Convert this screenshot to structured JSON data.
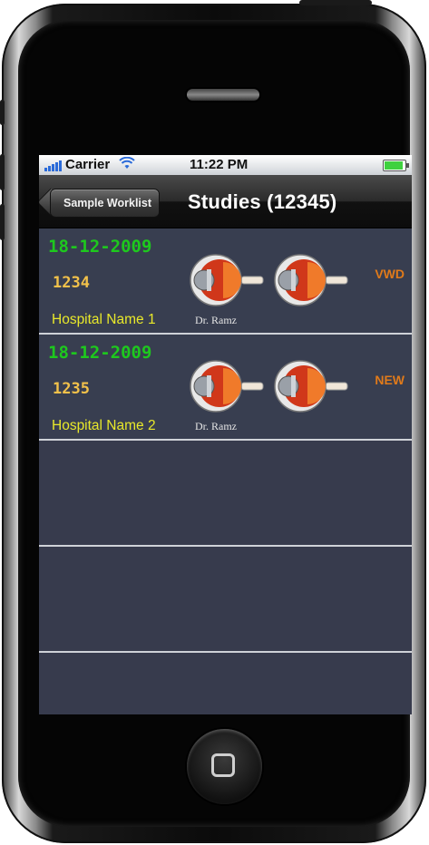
{
  "status_bar": {
    "carrier": "Carrier",
    "time": "11:22 PM",
    "battery_level": 1.0,
    "signal_icon": "signal-bars-icon",
    "wifi_icon": "wifi-icon",
    "accent_color": "#2b6bd9"
  },
  "nav": {
    "back_label": "Sample Worklist",
    "title": "Studies (12345)"
  },
  "studies": [
    {
      "date": "18-12-2009",
      "id": "1234",
      "hospital": "Hospital Name 1",
      "doctor": "Dr. Ramz",
      "status": "VWD"
    },
    {
      "date": "18-12-2009",
      "id": "1235",
      "hospital": "Hospital Name 2",
      "doctor": "Dr. Ramz",
      "status": "NEW"
    }
  ],
  "colors": {
    "date": "#1ec81e",
    "id": "#f2c14a",
    "hospital": "#e8e82a",
    "status": "#e07a1a",
    "screen_bg": "#373b4d"
  }
}
